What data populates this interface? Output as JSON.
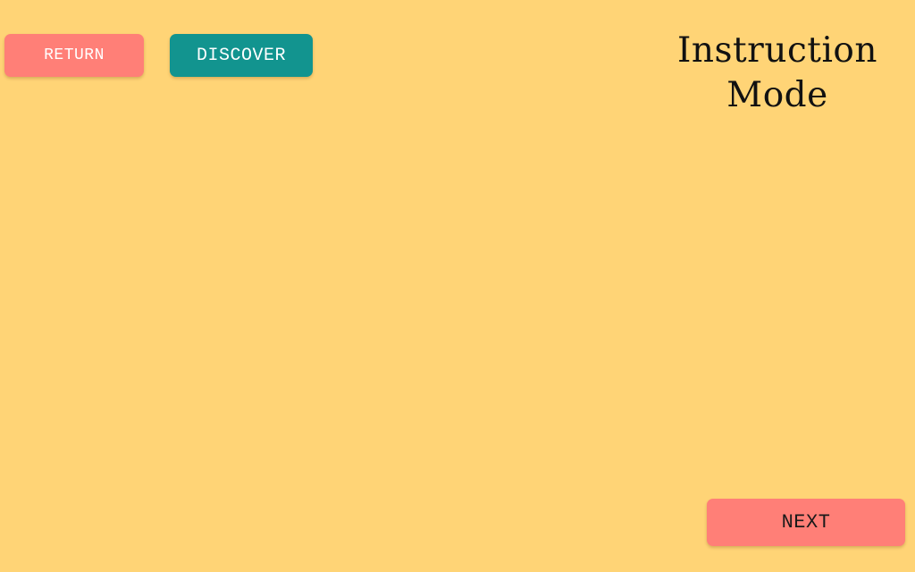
{
  "app": {
    "background_color": "#FFD476"
  },
  "header": {
    "return_label": "RETURN",
    "discover_label": "DISCOVER",
    "title_line1": "Instruction",
    "title_line2": "Mode"
  },
  "footer": {
    "next_label": "NEXT"
  },
  "colors": {
    "return_button": "#FF7F77",
    "discover_button": "#12948F",
    "next_button": "#FF7F77",
    "title_text": "#111111"
  }
}
